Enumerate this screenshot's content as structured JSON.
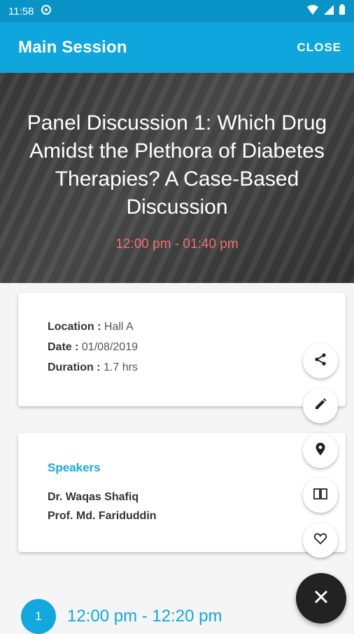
{
  "status_bar": {
    "time": "11:58"
  },
  "app_bar": {
    "title": "Main Session",
    "close_label": "CLOSE"
  },
  "session": {
    "title": "Panel Discussion 1: Which Drug Amidst the Plethora of Diabetes Therapies? A Case-Based Discussion",
    "time_range": "12:00 pm - 01:40 pm"
  },
  "details": {
    "location_label": "Location :",
    "location_value": "Hall A",
    "date_label": "Date :",
    "date_value": "01/08/2019",
    "duration_label": "Duration :",
    "duration_value": "1.7 hrs"
  },
  "speakers": {
    "heading": "Speakers",
    "items": [
      "Dr. Waqas Shafiq",
      "Prof. Md. Fariduddin"
    ]
  },
  "fab_actions": [
    "share-icon",
    "edit-icon",
    "location-pin-icon",
    "book-icon",
    "heart-icon",
    "close-icon"
  ],
  "timeline": [
    {
      "number": "1",
      "time": "12:00 pm - 12:20 pm"
    }
  ],
  "colors": {
    "primary": "#0ea6dc",
    "status_bar": "#0a93c7",
    "accent_time": "#f07070",
    "fab": "#222222"
  }
}
